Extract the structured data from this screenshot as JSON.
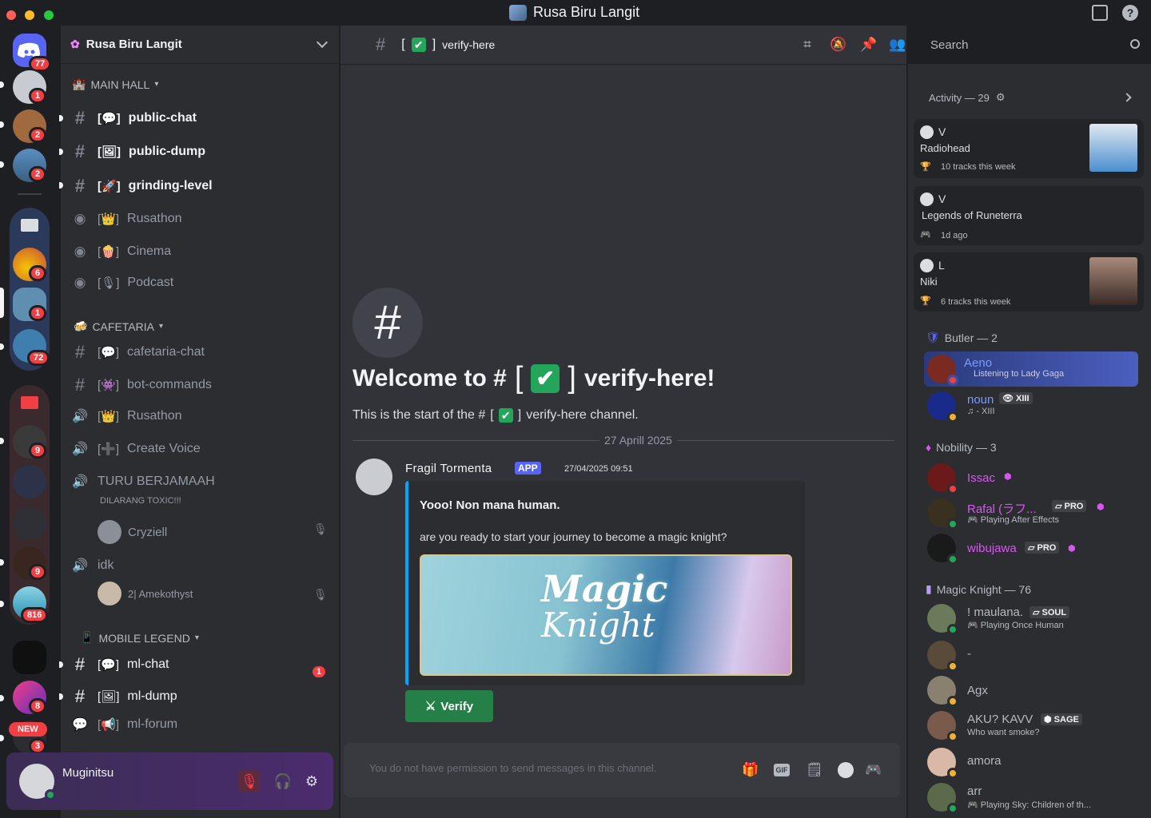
{
  "window": {
    "title": "Rusa Biru Langit"
  },
  "rail": {
    "home_badge": "77",
    "servers": [
      {
        "badge": "1"
      },
      {
        "badge": "2"
      },
      {
        "badge": "2"
      },
      {
        "badge": "6"
      },
      {
        "badge": "1"
      },
      {
        "badge": "72"
      },
      {
        "badge": "9"
      },
      {
        "badge": ""
      },
      {
        "badge": ""
      },
      {
        "badge": "9"
      },
      {
        "badge": "816"
      },
      {
        "badge": ""
      },
      {
        "badge": "8"
      },
      {
        "badge": "3"
      }
    ],
    "new_label": "NEW"
  },
  "sidebar": {
    "server_name": "Rusa Biru Langit",
    "categories": {
      "main_hall": "MAIN HALL",
      "cafetaria": "CAFETARIA",
      "mobile_legend": "MOBILE LEGEND"
    },
    "channels": {
      "public_chat": "public-chat",
      "public_dump": "public-dump",
      "grinding_level": "grinding-level",
      "rusathon_stage": "Rusathon",
      "cinema": "Cinema",
      "podcast": "Podcast",
      "cafetaria_chat": "cafetaria-chat",
      "bot_commands": "bot-commands",
      "rusathon_voice": "Rusathon",
      "create_voice": "Create Voice",
      "turu": "TURU BERJAMAAH",
      "turu_status": "DILARANG TOXIC!!!",
      "idk": "idk",
      "ml_chat": "ml-chat",
      "ml_dump": "ml-dump",
      "ml_forum": "ml-forum"
    },
    "voice_users": {
      "turu_user": "Cryziell",
      "idk_user": "2| Amekothyst"
    },
    "ml_chat_badge": "1",
    "user": {
      "name": "Muginitsu"
    }
  },
  "chat": {
    "channel": "verify-here",
    "search_placeholder": "Search",
    "welcome_prefix": "Welcome to #",
    "welcome_suffix": "verify-here!",
    "start_prefix": "This is the start of the #",
    "start_suffix": "verify-here channel.",
    "date_divider": "27 Aprill 2025",
    "message": {
      "author": "Fragil Tormenta",
      "tag": "APP",
      "time": "27/04/2025 09:51",
      "embed_title": "Yooo! Non mana human.",
      "embed_desc": "are you ready to start your journey to become a magic knight?",
      "image_text_1": "Magic",
      "image_text_2": "Knight",
      "button": "Verify"
    },
    "composer_placeholder": "You do not have permission to send messages in this channel."
  },
  "members": {
    "activity_header": "Activity — 29",
    "activities": [
      {
        "letter": "V",
        "title": "Radiohead",
        "meta": "10 tracks this week"
      },
      {
        "letter": "V",
        "title": "Legends of Runeterra",
        "meta": "1d ago"
      },
      {
        "letter": "L",
        "title": "Niki",
        "meta": "6 tracks this week"
      }
    ],
    "roles": {
      "butler": "Butler — 2",
      "nobility": "Nobility — 3",
      "magic_knight": "Magic Knight — 76"
    },
    "list": {
      "aeno": {
        "name": "Aeno",
        "sub": "Listening to Lady Gaga"
      },
      "noun": {
        "name": "noun",
        "tag": "XIII",
        "sub": "- XIII"
      },
      "issac": {
        "name": "Issac"
      },
      "rafal": {
        "name": "Rafal (ラフ...",
        "tag": "PRO",
        "sub": "Playing After Effects"
      },
      "wibujawa": {
        "name": "wibujawa",
        "tag": "PRO"
      },
      "maulana": {
        "name": "! maulana.",
        "tag": "SOUL",
        "sub": "Playing Once Human"
      },
      "dash": {
        "name": "-"
      },
      "agx": {
        "name": "Agx"
      },
      "akukavv": {
        "name": "AKU? KAVV",
        "tag": "SAGE",
        "sub": "Who want smoke?"
      },
      "amora": {
        "name": "amora"
      },
      "arr": {
        "name": "arr",
        "sub": "Playing Sky: Children of th..."
      }
    }
  },
  "colors": {
    "accent": "#5865f2",
    "online": "#23a55a",
    "dnd": "#f23f43",
    "nobility": "#d856f0",
    "butler_member": "#5865f2",
    "verify_button": "#248046"
  }
}
